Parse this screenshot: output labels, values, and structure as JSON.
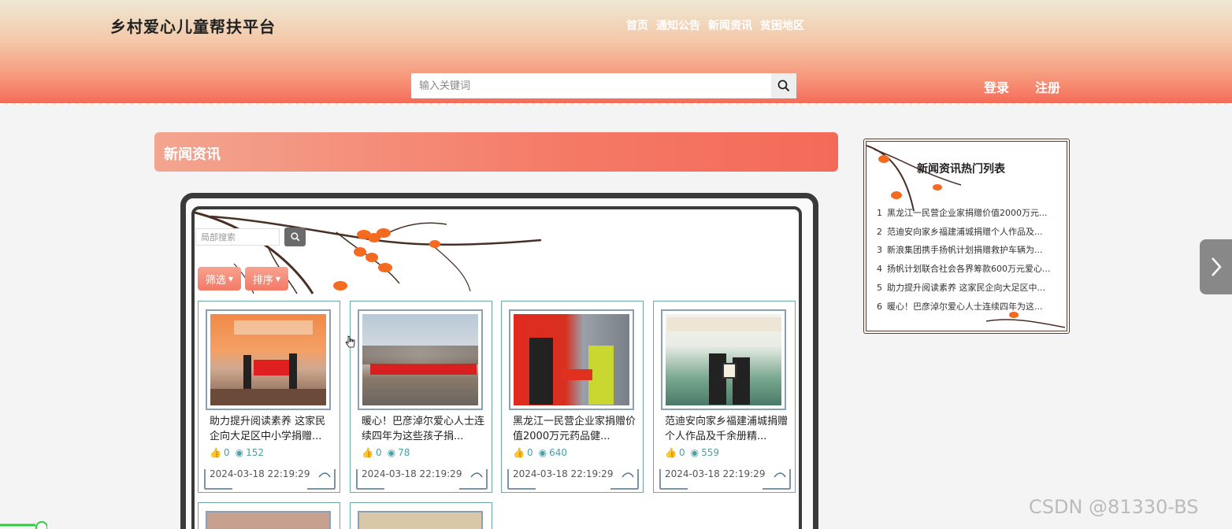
{
  "site": {
    "title": "乡村爱心儿童帮扶平台"
  },
  "nav": [
    {
      "label": "首页"
    },
    {
      "label": "通知公告"
    },
    {
      "label": "新闻资讯"
    },
    {
      "label": "贫困地区"
    }
  ],
  "search": {
    "placeholder": "输入关键词",
    "icon": "search-icon"
  },
  "auth": {
    "login": "登录",
    "register": "注册"
  },
  "section": {
    "title": "新闻资讯"
  },
  "local_search": {
    "placeholder": "局部搜索"
  },
  "filters": {
    "filter_label": "筛选",
    "sort_label": "排序"
  },
  "cards": [
    {
      "title": "助力提升阅读素养 这家民企向大足区中小学捐赠...",
      "likes": "0",
      "views": "152",
      "date": "2024-03-18 22:19:29"
    },
    {
      "title": "暖心！巴彦淖尔爱心人士连续四年为这些孩子捐...",
      "likes": "0",
      "views": "78",
      "date": "2024-03-18 22:19:29"
    },
    {
      "title": "黑龙江一民营企业家捐赠价值2000万元药品健...",
      "likes": "0",
      "views": "640",
      "date": "2024-03-18 22:19:29"
    },
    {
      "title": "范迪安向家乡福建浦城捐赠个人作品及千余册精...",
      "likes": "0",
      "views": "559",
      "date": "2024-03-18 22:19:29"
    }
  ],
  "hot": {
    "title": "新闻资讯热门列表",
    "items": [
      {
        "num": "1",
        "text": "黑龙江一民营企业家捐赠价值2000万元..."
      },
      {
        "num": "2",
        "text": "范迪安向家乡福建浦城捐赠个人作品及..."
      },
      {
        "num": "3",
        "text": "新浪集团携手扬帆计划捐赠救护车辆为..."
      },
      {
        "num": "4",
        "text": "扬帆计划联合社会各界筹款600万元爱心..."
      },
      {
        "num": "5",
        "text": "助力提升阅读素养 这家民企向大足区中..."
      },
      {
        "num": "6",
        "text": "暖心！巴彦淖尔爱心人士连续四年为这..."
      }
    ]
  },
  "watermark": "CSDN @81330-BS",
  "colors": {
    "accent": "#f47a66",
    "teal": "#4a9fa8",
    "frame": "#3a3a3a"
  }
}
